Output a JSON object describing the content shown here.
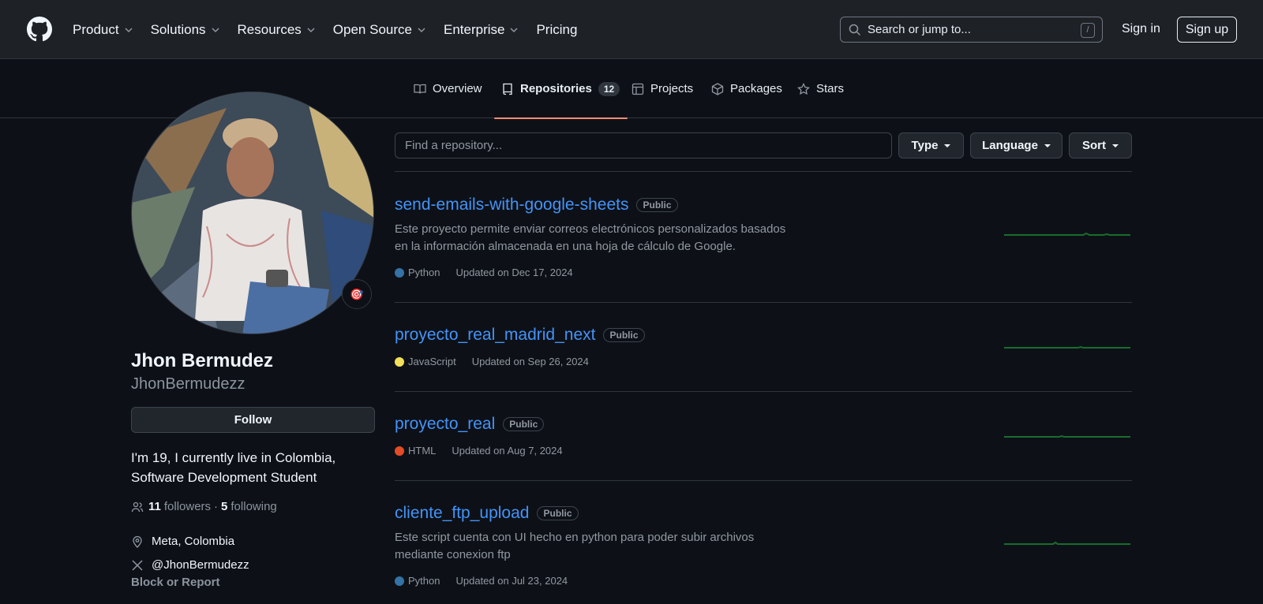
{
  "header": {
    "nav": [
      {
        "label": "Product",
        "has_menu": true
      },
      {
        "label": "Solutions",
        "has_menu": true
      },
      {
        "label": "Resources",
        "has_menu": true
      },
      {
        "label": "Open Source",
        "has_menu": true
      },
      {
        "label": "Enterprise",
        "has_menu": true
      },
      {
        "label": "Pricing",
        "has_menu": false
      }
    ],
    "search_placeholder": "Search or jump to...",
    "search_shortcut": "/",
    "signin_label": "Sign in",
    "signup_label": "Sign up"
  },
  "tabs": [
    {
      "label": "Overview",
      "icon": "book-icon",
      "active": false
    },
    {
      "label": "Repositories",
      "icon": "repo-icon",
      "active": true,
      "count": "12"
    },
    {
      "label": "Projects",
      "icon": "table-icon",
      "active": false
    },
    {
      "label": "Packages",
      "icon": "package-icon",
      "active": false
    },
    {
      "label": "Stars",
      "icon": "star-icon",
      "active": false
    }
  ],
  "profile": {
    "name": "Jhon Bermudez",
    "login": "JhonBermudezz",
    "follow_label": "Follow",
    "bio": "I'm 19, I currently live in Colombia, Software Development Student",
    "followers_count": "11",
    "followers_label": "followers",
    "separator": "·",
    "following_count": "5",
    "following_label": "following",
    "location": "Meta, Colombia",
    "twitter": "@JhonBermudezz",
    "block_label": "Block or Report",
    "status_emoji": "🎯"
  },
  "filters": {
    "find_placeholder": "Find a repository...",
    "type_label": "Type",
    "language_label": "Language",
    "sort_label": "Sort"
  },
  "repos": [
    {
      "name": "send-emails-with-google-sheets",
      "visibility": "Public",
      "description": "Este proyecto permite enviar correos electrónicos personalizados basados en la información almacenada en una hoja de cálculo de Google.",
      "language": "Python",
      "language_color": "#3572A5",
      "updated": "Updated on Dec 17, 2024"
    },
    {
      "name": "proyecto_real_madrid_next",
      "visibility": "Public",
      "description": "",
      "language": "JavaScript",
      "language_color": "#f1e05a",
      "updated": "Updated on Sep 26, 2024"
    },
    {
      "name": "proyecto_real",
      "visibility": "Public",
      "description": "",
      "language": "HTML",
      "language_color": "#e34c26",
      "updated": "Updated on Aug 7, 2024"
    },
    {
      "name": "cliente_ftp_upload",
      "visibility": "Public",
      "description": "Este script cuenta con UI hecho en python para poder subir archivos mediante conexion ftp",
      "language": "Python",
      "language_color": "#3572A5",
      "updated": "Updated on Jul 23, 2024"
    }
  ],
  "colors": {
    "link": "#4493f8",
    "tab_underline": "#fd8c73",
    "sparkline": "#196c2e"
  }
}
